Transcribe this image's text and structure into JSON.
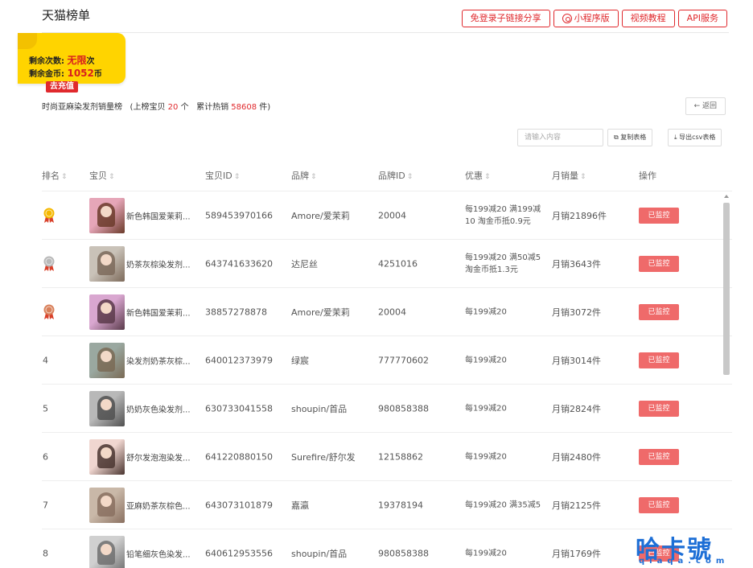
{
  "header": {
    "title": "天猫榜单",
    "actions": [
      "免登录子链接分享",
      "小程序版",
      "视频教程",
      "API服务"
    ]
  },
  "quota": {
    "times_label": "剩余次数:",
    "times_value": "无限",
    "times_unit": "次",
    "coins_label": "剩余金币:",
    "coins_value": "1052",
    "coins_unit": "币",
    "recharge_label": "去充值"
  },
  "subheading": {
    "prefix": "时尚亚麻染发剂销量榜",
    "count_prefix": "(上榜宝贝",
    "count": "20",
    "count_suffix": "个",
    "sales_prefix": "累计热销",
    "sales": "58608",
    "sales_suffix": "件)"
  },
  "back_label": "← 返回",
  "search": {
    "placeholder": "请输入内容"
  },
  "tools": {
    "copy_label": "复制表格",
    "export_label": "导出csv表格"
  },
  "columns": [
    "排名",
    "宝贝",
    "宝贝ID",
    "品牌",
    "品牌ID",
    "优惠",
    "月销量",
    "操作"
  ],
  "rows": [
    {
      "rank": "",
      "medal": "gold",
      "name": "新色韩国爱茉莉...",
      "id": "589453970166",
      "brand": "Amore/爱茉莉",
      "brand_id": "20004",
      "promo": "每199减20 满199减10 淘金币抵0.9元",
      "sales": "月销21896件",
      "action": "已监控"
    },
    {
      "rank": "",
      "medal": "silver",
      "name": "奶茶灰棕染发剂...",
      "id": "643741633620",
      "brand": "达尼丝",
      "brand_id": "4251016",
      "promo": "每199减20 满50减5 淘金币抵1.3元",
      "sales": "月销3643件",
      "action": "已监控"
    },
    {
      "rank": "",
      "medal": "bronze",
      "name": "新色韩国爱茉莉...",
      "id": "38857278878",
      "brand": "Amore/爱茉莉",
      "brand_id": "20004",
      "promo": "每199减20",
      "sales": "月销3072件",
      "action": "已监控"
    },
    {
      "rank": "4",
      "medal": "",
      "name": "染发剂奶茶灰棕...",
      "id": "640012373979",
      "brand": "绿宸",
      "brand_id": "777770602",
      "promo": "每199减20",
      "sales": "月销3014件",
      "action": "已监控"
    },
    {
      "rank": "5",
      "medal": "",
      "name": "奶奶灰色染发剂...",
      "id": "630733041558",
      "brand": "shoupin/首品",
      "brand_id": "980858388",
      "promo": "每199减20",
      "sales": "月销2824件",
      "action": "已监控"
    },
    {
      "rank": "6",
      "medal": "",
      "name": "舒尔发泡泡染发...",
      "id": "641220880150",
      "brand": "Surefire/舒尔发",
      "brand_id": "12158862",
      "promo": "每199减20",
      "sales": "月销2480件",
      "action": "已监控"
    },
    {
      "rank": "7",
      "medal": "",
      "name": "亚麻奶茶灰棕色...",
      "id": "643073101879",
      "brand": "嘉瀛",
      "brand_id": "19378194",
      "promo": "每199减20 满35减5",
      "sales": "月销2125件",
      "action": "已监控"
    },
    {
      "rank": "8",
      "medal": "",
      "name": "铅笔细灰色染发...",
      "id": "640612953556",
      "brand": "shoupin/首品",
      "brand_id": "980858388",
      "promo": "每199减20",
      "sales": "月销1769件",
      "action": "已监控"
    }
  ],
  "watermark": {
    "text": "哈卡號",
    "sub": "qiaqa.com"
  },
  "colors": {
    "accent": "#e0292d",
    "monitor": "#ef6a6a",
    "quota_bg": "#ffd400",
    "gold": "#f5b800",
    "silver": "#b9b9b9",
    "bronze": "#d9805a"
  }
}
